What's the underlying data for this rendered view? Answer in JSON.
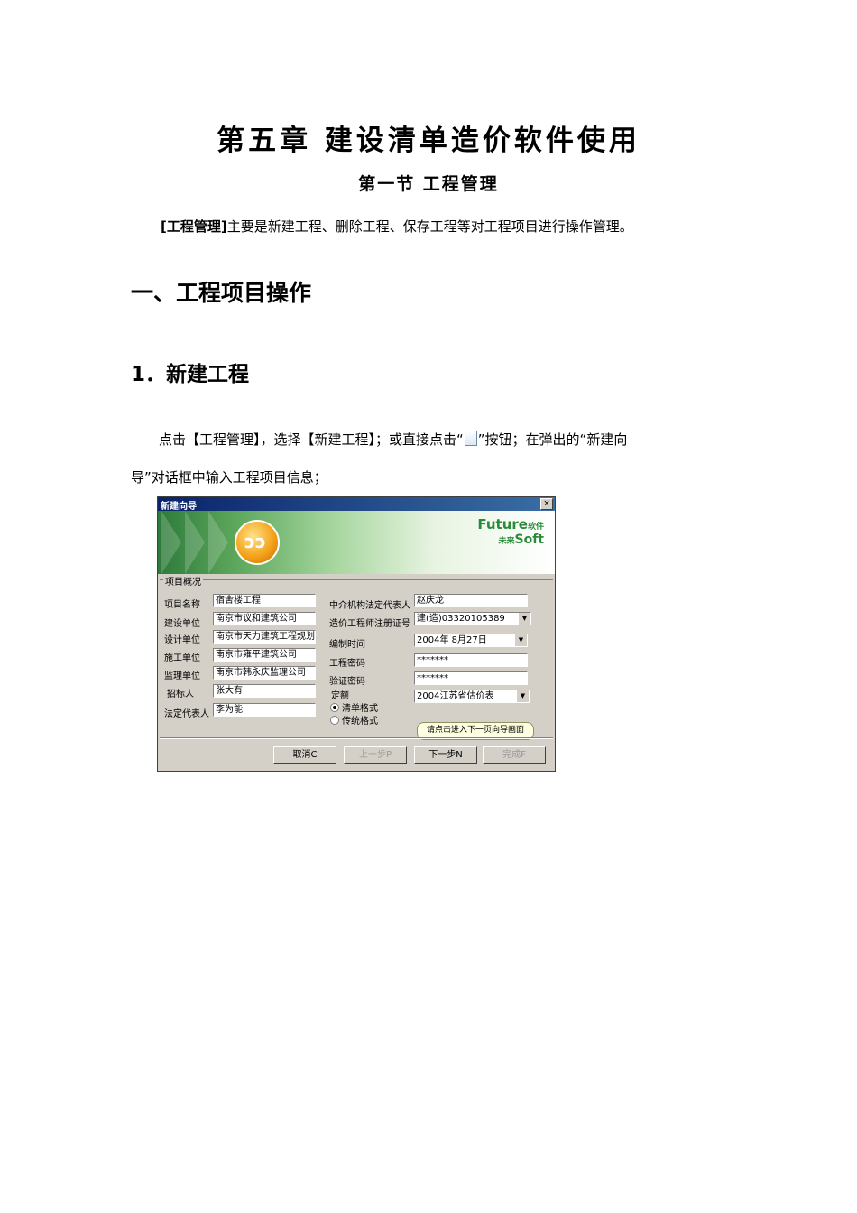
{
  "chapter_title": "第五章  建设清单造价软件使用",
  "section_title": "第一节  工程管理",
  "intro": {
    "bold": "[工程管理]",
    "text": "主要是新建工程、删除工程、保存工程等对工程项目进行操作管理。"
  },
  "heading1": "一、工程项目操作",
  "heading2": "1．新建工程",
  "para": {
    "line1_before": "点击【工程管理】，选择【新建工程】；或直接点击“",
    "line1_after": "”按钮；在弹出的“新建向",
    "line2": "导”对话框中输入工程项目信息；"
  },
  "dialog": {
    "title": "新建向导",
    "close": "×",
    "brand_top": "Future",
    "brand_top_cn": "软件",
    "brand_bottom_cn": "未来",
    "brand_bottom": "Soft",
    "group_label": "项目概况",
    "left_fields": [
      {
        "label": "项目名称",
        "value": "宿舍楼工程"
      },
      {
        "label": "建设单位",
        "value": "南京市议和建筑公司"
      },
      {
        "label": "设计单位",
        "value": "南京市天力建筑工程规划"
      },
      {
        "label": "施工单位",
        "value": "南京市雍平建筑公司"
      },
      {
        "label": "监理单位",
        "value": "南京市韩永庆监理公司"
      },
      {
        "label": "招标人",
        "value": "张大有"
      },
      {
        "label": "法定代表人",
        "value": "李为能"
      }
    ],
    "right_fields": [
      {
        "label": "中介机构法定代表人",
        "value": "赵庆龙"
      },
      {
        "label": "造价工程师注册证号",
        "value": "建(造)03320105389"
      },
      {
        "label": "编制时间",
        "value": "2004年  8月27日"
      },
      {
        "label": "工程密码",
        "value": "*******"
      },
      {
        "label": "验证密码",
        "value": "*******"
      },
      {
        "label": "定额",
        "value": "2004江苏省估价表"
      }
    ],
    "radio_options": [
      "清单格式",
      "传统格式"
    ],
    "tooltip": "请点击进入下一页向导画面",
    "buttons": {
      "cancel": "取消C",
      "prev": "上一步P",
      "next": "下一步N",
      "finish": "完成F"
    }
  }
}
